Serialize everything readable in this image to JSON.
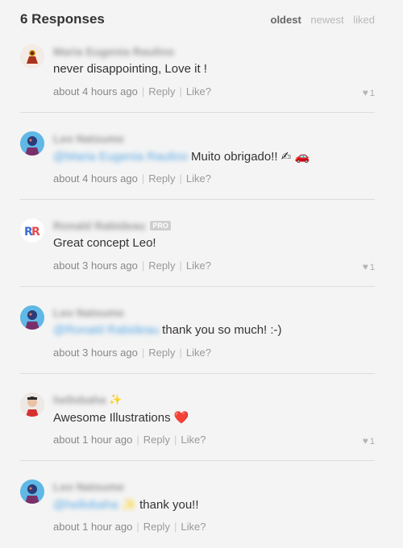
{
  "header": {
    "title": "6 Responses",
    "sort": {
      "oldest": "oldest",
      "newest": "newest",
      "liked": "liked"
    }
  },
  "comments": [
    {
      "author": "Maria Eugenia Raulino",
      "body": "never disappointing, Love it !",
      "time": "about 4 hours ago",
      "reply": "Reply",
      "like": "Like?",
      "likes": "1"
    },
    {
      "author": "Leo Natsume",
      "mention": "@Maria Eugenia Raulino",
      "body": "Muito obrigado!! ✍ 🚗",
      "time": "about 4 hours ago",
      "reply": "Reply",
      "like": "Like?"
    },
    {
      "author": "Ronald Rabideau",
      "badge": "PRO",
      "body": "Great concept Leo!",
      "time": "about 3 hours ago",
      "reply": "Reply",
      "like": "Like?",
      "likes": "1"
    },
    {
      "author": "Leo Natsume",
      "mention": "@Ronald Rabideau",
      "body": "thank you so much! :-)",
      "time": "about 3 hours ago",
      "reply": "Reply",
      "like": "Like?"
    },
    {
      "author": "hellobaha",
      "body": "Awesome Illustrations ❤️",
      "time": "about 1 hour ago",
      "reply": "Reply",
      "like": "Like?",
      "likes": "1"
    },
    {
      "author": "Leo Natsume",
      "mention": "@hellobaha ✨",
      "body": "thank you!!",
      "time": "about 1 hour ago",
      "reply": "Reply",
      "like": "Like?"
    }
  ],
  "icons": {
    "like": "heart-icon",
    "accent": "#5aa9e6"
  }
}
